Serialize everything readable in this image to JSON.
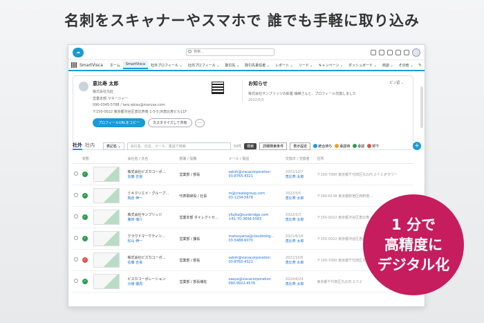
{
  "headline": "名刺をスキャナーやスマホで 誰でも手軽に取り込み",
  "app": {
    "logo_text": "☁",
    "search_placeholder": "検索...",
    "name": "SmartVisca",
    "nav": [
      "ホーム",
      "SmartVisca",
      "社外プロフィール ⌄",
      "社内プロフィール ⌄",
      "取引先 ⌄",
      "取引先責任者 ⌄",
      "レポート ⌄",
      "リード ⌄",
      "キャンペーン ⌄",
      "ダッシュボード ⌄",
      "商談 ⌄",
      "その他 ⌄"
    ],
    "nav_active_index": 1
  },
  "profile": {
    "name": "恵比寿 太郎",
    "company": "株式会社丸紅",
    "dept": "営業本部 マネージャー",
    "email": "090-0345-5788 / taro.ebisu@marusa.com",
    "address": "〒150-0022 東京都渋谷区恵比寿南 1-5-5 JR恵比寿ビル11F",
    "btn_primary": "プロフィールURLをコピー",
    "btn_outline": "カスタマイズして共有",
    "btn_more": "···"
  },
  "notice": {
    "title": "お知らせ",
    "text": "株式会社サンブリッジの鈴置 瑞稀さんと、プロフィール交換しました",
    "date": "2022/5/3",
    "more": "ピン留 ⌄"
  },
  "tabs": [
    "社外",
    "社内"
  ],
  "filter": {
    "select": "表記名 ⌄",
    "placeholder": "会社名、氏名、メール、電話で検索",
    "count": "50件",
    "search_btn": "検索",
    "btn1": "詳細検索条件",
    "btn2": "表示設定",
    "legend": [
      {
        "label": "統合待ち",
        "color": "#1a9ad6"
      },
      {
        "label": "承認待",
        "color": "#f0a020"
      },
      {
        "label": "承認",
        "color": "#2e9b4a"
      },
      {
        "label": "却下",
        "color": "#d9534f"
      }
    ],
    "add": "+"
  },
  "table": {
    "headers": [
      "",
      "状態",
      "",
      "会社名 / 氏名",
      "部署 / 役職",
      "メール / 電話",
      "交換日 / 交換者",
      "住所"
    ],
    "rows": [
      {
        "status": "ok",
        "company": "株式会社ビズカコーポ…",
        "person": "佐藤 吉良",
        "dept": "営業部 / 部長",
        "email": "satoh@viscacorporation",
        "phone": "03-8765-4321",
        "date": "2021/10/7",
        "owner": "恵比寿 太郎",
        "address": "〒100-7090 東京都千代田区丸の内 2-7-2 JPタワー"
      },
      {
        "status": "ok",
        "company": "ミキクリエイ・グループ…",
        "person": "駒倉 伸一",
        "dept": "代表取締役 / 社長",
        "email": "m@creategroup.com",
        "phone": "03-1234-5678",
        "date": "2022/5/5",
        "owner": "恵比寿 太郎",
        "address": "〒160-8138 東京都新宿区西新宿…"
      },
      {
        "status": "ok",
        "company": "株式会社サンブリッジ",
        "person": "藤田 瑞介",
        "dept": "営業本部 ダイレクトセ…",
        "email": "yfujita@sunbridge.com",
        "phone": "+81-70-3656-5583",
        "date": "2022/5/3",
        "owner": "恵比寿 太郎",
        "address": "〒150-0022 東京都渋谷区恵比寿…"
      },
      {
        "status": "ok",
        "company": "クラウドマーケティン…",
        "person": "松山 伸一",
        "dept": "営業部 / 課長",
        "email": "matsuyama@cloudmktg…",
        "phone": "03-5488-6070",
        "date": "2021/6/18",
        "owner": "恵比寿 太郎",
        "address": "〒150-0022 東京都渋谷区恵比寿…"
      },
      {
        "status": "ng",
        "company": "株式会社ビズカコーポ…",
        "person": "佐藤 吉良",
        "dept": "営業部 / 部長",
        "email": "satoh@viscacorporation",
        "phone": "03-8765-4321",
        "date": "2021/10/6",
        "owner": "恵比寿 太郎",
        "address": "〒100-7090 東京都千代田区丸の内…"
      },
      {
        "status": "ok",
        "company": "ビスカコーポレーション",
        "person": "沙綾 優周",
        "dept": "営業部 / 部長補佐",
        "email": "saaya@viscacorporation",
        "phone": "090-9922-4576",
        "date": "2020/6/24",
        "owner": "恵比寿 太郎",
        "address": "東京都千代田区丸の内 2-7-2"
      }
    ]
  },
  "badge_lines": [
    "1 分で",
    "高精度に",
    "デジタル化"
  ]
}
